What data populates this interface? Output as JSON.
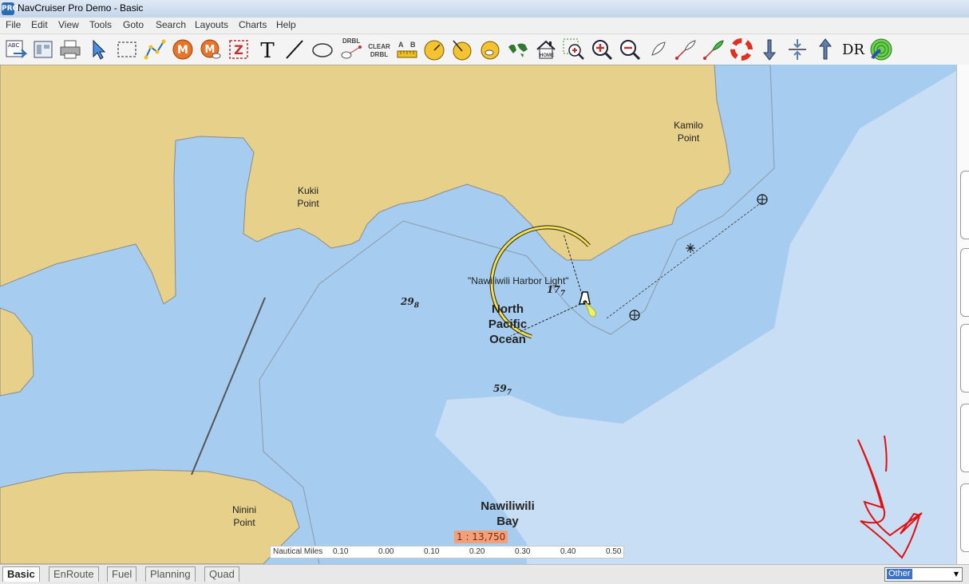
{
  "window": {
    "title": "NavCruiser Pro Demo - Basic",
    "app_icon": "PRO"
  },
  "menu": [
    "File",
    "Edit",
    "View",
    "Tools",
    "Goto",
    "Search",
    "Layouts",
    "Charts",
    "Help"
  ],
  "toolbar": {
    "drbl_label": "DRBL",
    "clear_drbl_label_1": "CLEAR",
    "clear_drbl_label_2": "DRBL",
    "range_a": "A",
    "range_b": "B",
    "home_label": "HOME",
    "dr_label": "DR",
    "m1_label": "M",
    "m2_label": "M",
    "z_label": "Z",
    "text_tool_label": "T"
  },
  "map": {
    "places": {
      "kamilo": [
        "Kamilo",
        "Point"
      ],
      "kukii": [
        "Kukii",
        "Point"
      ],
      "ninini": [
        "Ninini",
        "Point"
      ],
      "ocean": [
        "North",
        "Pacific",
        "Ocean"
      ],
      "bay": [
        "Nawiliwili",
        "Bay"
      ]
    },
    "light_label": "\"Nawiliwili Harbor Light\"",
    "soundings": [
      {
        "value": "29",
        "sub": "8"
      },
      {
        "value": "17",
        "sub": "7"
      },
      {
        "value": "59",
        "sub": "7"
      }
    ],
    "scale_ratio": "1 : 13,750",
    "scale_bar": {
      "unit": "Nautical Miles",
      "ticks": [
        "0.10",
        "0.00",
        "0.10",
        "0.20",
        "0.30",
        "0.40",
        "0.50"
      ]
    },
    "colors": {
      "land": "#e6d08a",
      "shallow": "#a6cdf0",
      "deep": "#c7def5",
      "annotation": "#e01010"
    }
  },
  "tabs": [
    "Basic",
    "EnRoute",
    "Fuel",
    "Planning",
    "Quad"
  ],
  "active_tab": "Basic",
  "chart_select": {
    "value": "Other"
  }
}
